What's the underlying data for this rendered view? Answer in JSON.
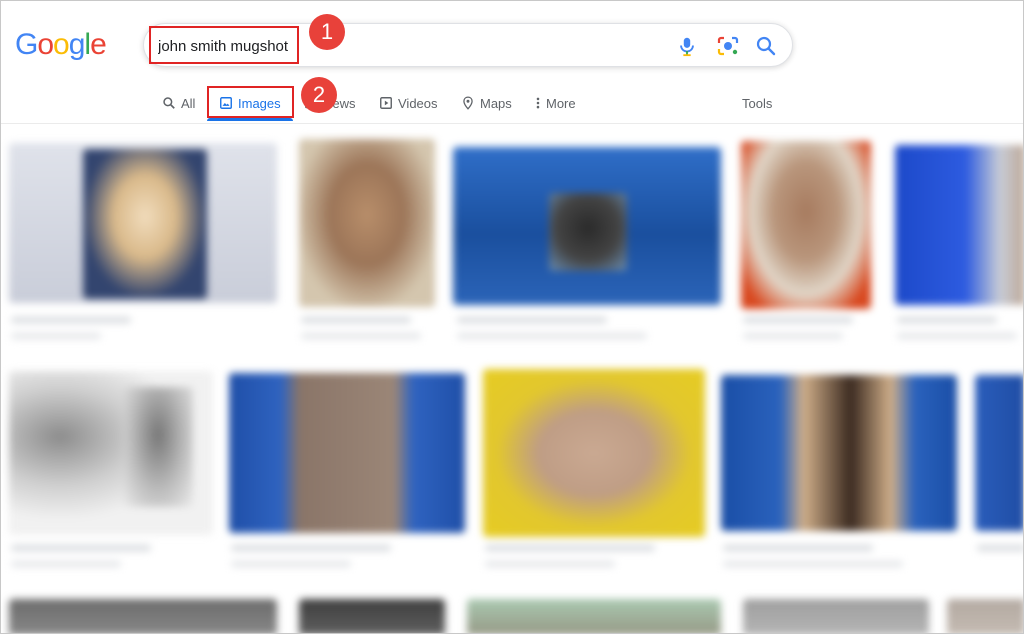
{
  "logo": {
    "text": "Google",
    "letters": [
      "G",
      "o",
      "o",
      "g",
      "l",
      "e"
    ],
    "colors": [
      "#4285f4",
      "#ea4335",
      "#fbbc05",
      "#4285f4",
      "#34a853",
      "#ea4335"
    ]
  },
  "search": {
    "value": "john smith mugshot",
    "mic_icon": "microphone-icon",
    "lens_icon": "camera-lens-icon",
    "submit_icon": "search-icon"
  },
  "tabs": [
    {
      "label": "All",
      "icon": "search-icon"
    },
    {
      "label": "Images",
      "icon": "image-icon",
      "active": true
    },
    {
      "label": "News",
      "icon": "news-icon"
    },
    {
      "label": "Videos",
      "icon": "play-icon"
    },
    {
      "label": "Maps",
      "icon": "map-pin-icon"
    },
    {
      "label": "More",
      "icon": "more-vertical-icon"
    }
  ],
  "tools_label": "Tools",
  "annotations": {
    "step1": "1",
    "step2": "2",
    "color": "#e02424"
  },
  "accent": "#1a73e8"
}
